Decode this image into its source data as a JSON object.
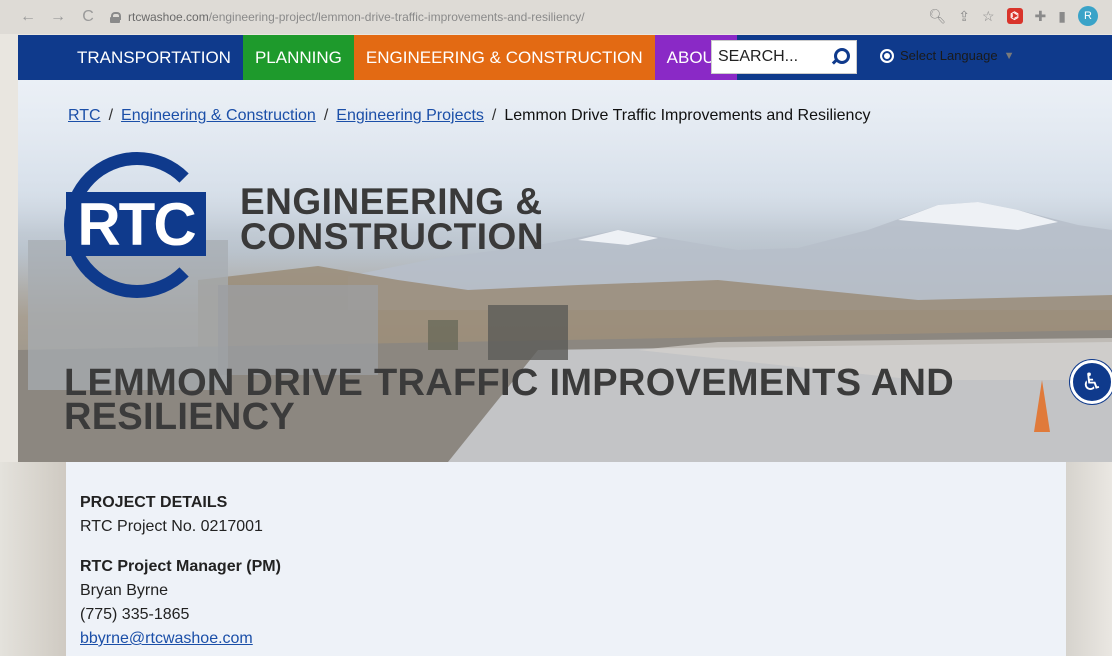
{
  "browser": {
    "url_domain": "rtcwashoe.com",
    "url_path": "/engineering-project/lemmon-drive-traffic-improvements-and-resiliency/",
    "back": "←",
    "forward": "→",
    "reload": "C",
    "profile_initial": "R"
  },
  "nav": {
    "items": [
      {
        "label": "TRANSPORTATION"
      },
      {
        "label": "PLANNING"
      },
      {
        "label": "ENGINEERING & CONSTRUCTION"
      },
      {
        "label": "ABOUT"
      }
    ],
    "search_placeholder": "SEARCH...",
    "language_label": "Select Language",
    "colors": {
      "bar": "#0f3a8c",
      "planning": "#1e9a2c",
      "engineering": "#e36a13",
      "about": "#8a29c6"
    }
  },
  "breadcrumb": {
    "items": [
      "RTC",
      "Engineering & Construction",
      "Engineering Projects"
    ],
    "current": "Lemmon Drive Traffic Improvements and Resiliency",
    "separator": "/"
  },
  "hero": {
    "logo_text": "RTC",
    "section_line1": "ENGINEERING &",
    "section_line2": "CONSTRUCTION",
    "page_title": "LEMMON DRIVE TRAFFIC IMPROVEMENTS AND RESILIENCY"
  },
  "details": {
    "heading": "PROJECT DETAILS",
    "project_no": "RTC Project No. 0217001",
    "pm_label": "RTC Project Manager (PM)",
    "pm_name": "Bryan Byrne",
    "pm_phone": "(775) 335-1865",
    "pm_email": "bbyrne@rtcwashoe.com"
  }
}
